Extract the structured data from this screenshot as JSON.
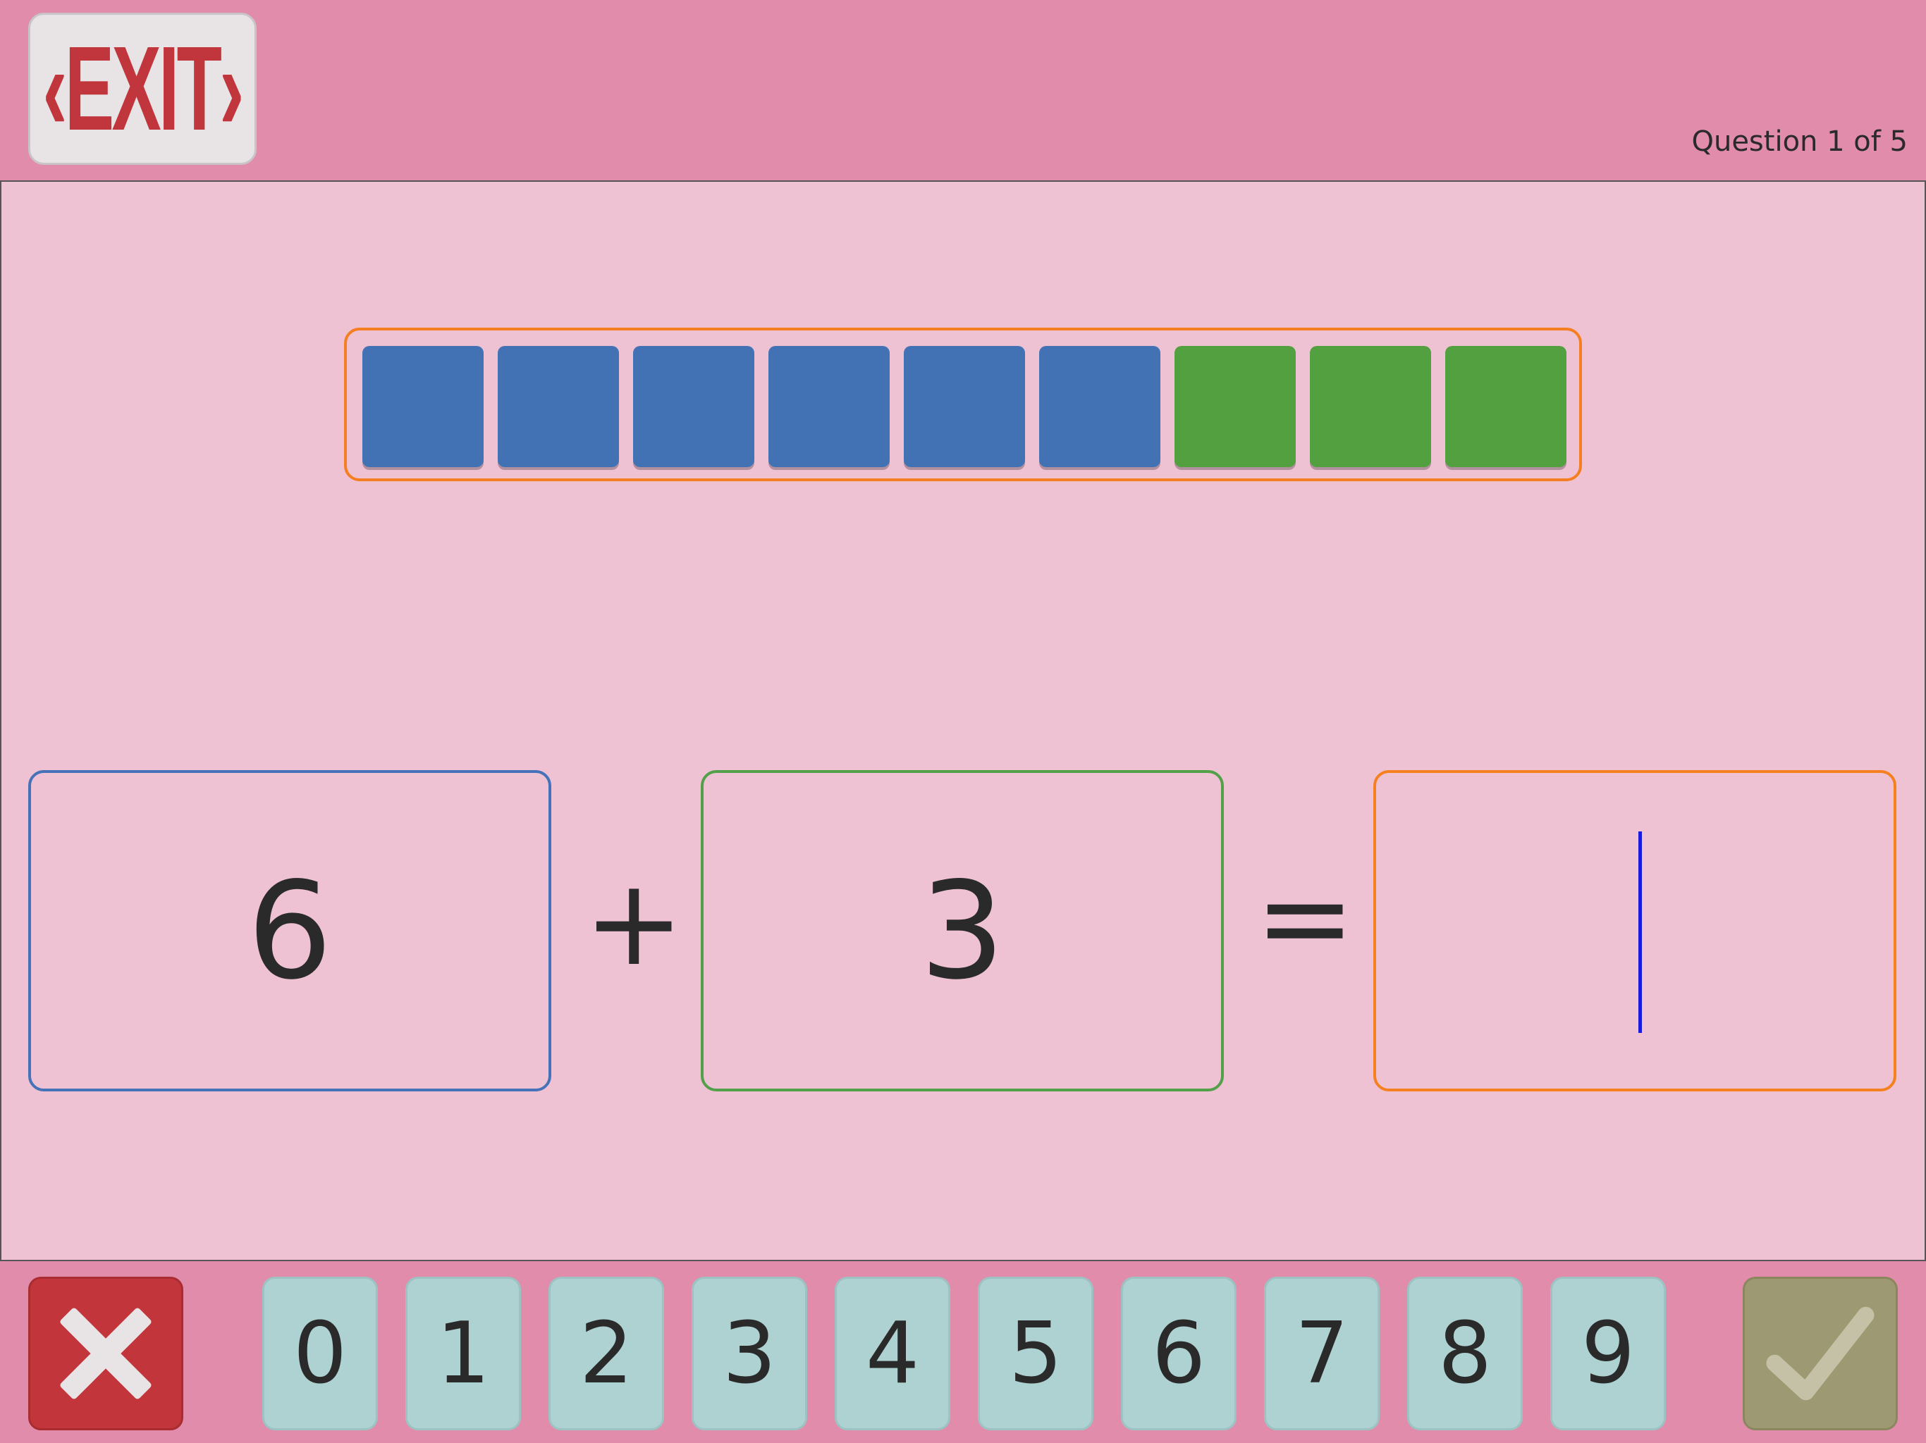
{
  "header": {
    "exit_label": "‹EXIT›",
    "question_status": "Question 1 of 5"
  },
  "ten_frame": {
    "total_slots": 9,
    "blue_count": 6,
    "green_count": 3,
    "colors": {
      "frame": "#f57f20",
      "blue": "#4372b4",
      "green": "#52a040"
    }
  },
  "equation": {
    "addend_a": "6",
    "operator": "+",
    "addend_b": "3",
    "equals": "=",
    "answer": ""
  },
  "keypad": {
    "clear_icon": "x-icon",
    "keys": [
      "0",
      "1",
      "2",
      "3",
      "4",
      "5",
      "6",
      "7",
      "8",
      "9"
    ],
    "submit_icon": "checkmark-icon"
  },
  "colors": {
    "header_bg": "#e18cab",
    "body_bg": "#eec1d3",
    "clear_bg": "#c1353b",
    "key_bg": "#aed2d1",
    "submit_bg": "#9d9a73"
  }
}
